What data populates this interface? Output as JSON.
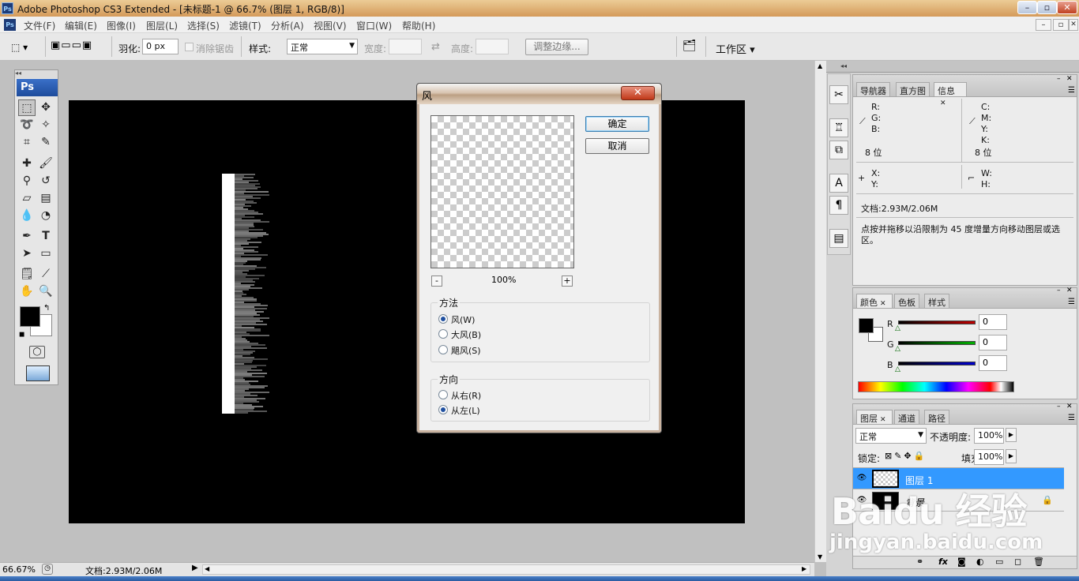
{
  "window": {
    "app_icon": "Ps",
    "title": "Adobe Photoshop CS3 Extended - [未标题-1 @ 66.7% (图层 1, RGB/8)]"
  },
  "menubar": {
    "app_icon": "Ps",
    "items": [
      "文件(F)",
      "编辑(E)",
      "图像(I)",
      "图层(L)",
      "选择(S)",
      "滤镜(T)",
      "分析(A)",
      "视图(V)",
      "窗口(W)",
      "帮助(H)"
    ]
  },
  "options": {
    "feather_label": "羽化:",
    "feather_value": "0 px",
    "antialias_label": "消除锯齿",
    "style_label": "样式:",
    "style_value": "正常",
    "width_label": "宽度:",
    "height_label": "高度:",
    "refine_edge": "调整边缘...",
    "workspace": "工作区 ▾"
  },
  "toolbox": {
    "logo": "Ps"
  },
  "dialog": {
    "title": "风",
    "ok": "确定",
    "cancel": "取消",
    "zoom_out": "-",
    "zoom": "100%",
    "zoom_in": "+",
    "method_label": "方法",
    "methods": [
      "风(W)",
      "大风(B)",
      "飓风(S)"
    ],
    "method_selected": 0,
    "direction_label": "方向",
    "directions": [
      "从右(R)",
      "从左(L)"
    ],
    "direction_selected": 1
  },
  "info_panel": {
    "tabs": [
      "导航器",
      "直方图",
      "信息"
    ],
    "active_tab": 2,
    "left_channels": [
      "R:",
      "G:",
      "B:"
    ],
    "right_channels": [
      "C:",
      "M:",
      "Y:",
      "K:"
    ],
    "left_bits": "8 位",
    "right_bits": "8 位",
    "x": "X:",
    "y": "Y:",
    "w": "W:",
    "h": "H:",
    "doc": "文档:2.93M/2.06M",
    "hint": "点按并拖移以沿限制为 45 度增量方向移动图层或选区。"
  },
  "color_panel": {
    "tabs": [
      "颜色",
      "色板",
      "样式"
    ],
    "active_tab": 0,
    "channels": [
      {
        "label": "R",
        "value": "0",
        "color": "#c00000"
      },
      {
        "label": "G",
        "value": "0",
        "color": "#00a000"
      },
      {
        "label": "B",
        "value": "0",
        "color": "#0000c0"
      }
    ]
  },
  "layers_panel": {
    "tabs": [
      "图层",
      "通道",
      "路径"
    ],
    "active_tab": 0,
    "blend": "正常",
    "opacity_label": "不透明度:",
    "opacity": "100%",
    "lock_label": "锁定:",
    "fill_label": "填充:",
    "fill": "100%",
    "layers": [
      {
        "name": "图层 1",
        "selected": true
      },
      {
        "name": "背景",
        "selected": false,
        "locked": true
      }
    ]
  },
  "status": {
    "zoom": "66.67%",
    "doc": "文档:2.93M/2.06M"
  },
  "watermark": {
    "line1": "Baidu 经验",
    "line2": "jingyan.baidu.com"
  },
  "colors": {
    "accent": "#3399ff",
    "layer_selected": "#3399ff"
  }
}
